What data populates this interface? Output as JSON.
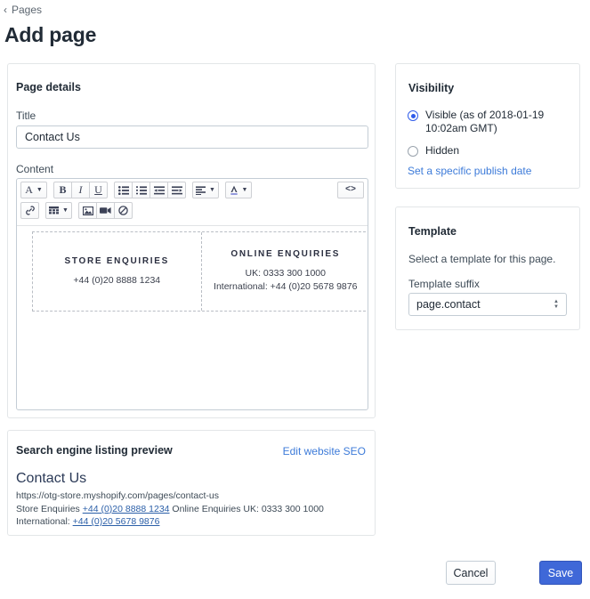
{
  "breadcrumb": {
    "label": "Pages",
    "icon": "chevron-left-icon"
  },
  "page_title": "Add page",
  "page_details": {
    "card_title": "Page details",
    "title_label": "Title",
    "title_value": "Contact Us",
    "title_placeholder": "",
    "content_label": "Content",
    "toolbar": {
      "row1": [
        {
          "name": "font-style-dropdown",
          "glyph": "A",
          "caret": true
        },
        {
          "name": "bold-button",
          "glyph": "B",
          "caret": false
        },
        {
          "name": "italic-button",
          "glyph": "I",
          "caret": false
        },
        {
          "name": "underline-button",
          "glyph": "U",
          "caret": false
        },
        {
          "name": "bulleted-list-button",
          "glyph": "list-bullet-icon",
          "caret": false
        },
        {
          "name": "numbered-list-button",
          "glyph": "list-number-icon",
          "caret": false
        },
        {
          "name": "outdent-button",
          "glyph": "outdent-icon",
          "caret": false
        },
        {
          "name": "indent-button",
          "glyph": "indent-icon",
          "caret": false
        },
        {
          "name": "align-dropdown",
          "glyph": "align-left-icon",
          "caret": true
        },
        {
          "name": "text-color-dropdown",
          "glyph": "text-color-icon",
          "caret": true
        },
        {
          "name": "edit-html-button",
          "glyph": "code-icon",
          "caret": false
        }
      ],
      "row2": [
        {
          "name": "insert-link-button",
          "glyph": "link-icon",
          "caret": false
        },
        {
          "name": "insert-table-dropdown",
          "glyph": "table-icon",
          "caret": true
        },
        {
          "name": "insert-image-button",
          "glyph": "image-icon",
          "caret": false
        },
        {
          "name": "insert-video-button",
          "glyph": "video-icon",
          "caret": false
        },
        {
          "name": "clear-formatting-button",
          "glyph": "no-formatting-icon",
          "caret": false
        }
      ]
    },
    "content_table": {
      "cells": [
        {
          "heading": "STORE ENQUIRIES",
          "lines": [
            "+44 (0)20 8888 1234"
          ]
        },
        {
          "heading": "ONLINE ENQUIRIES",
          "lines": [
            "UK: 0333 300 1000",
            "International: +44 (0)20 5678 9876"
          ]
        }
      ]
    },
    "scrollbars": {
      "left_arrow": "‹",
      "right_arrow": "›",
      "thumb_percent": 83
    }
  },
  "seo": {
    "card_title": "Search engine listing preview",
    "edit_link": "Edit website SEO",
    "heading": "Contact Us",
    "url": "https://otg-store.myshopify.com/pages/contact-us",
    "description_parts": [
      {
        "text": "Store Enquiries ",
        "link": false
      },
      {
        "text": "+44 (0)20 8888 1234",
        "link": true
      },
      {
        "text": " Online Enquiries UK: 0333 300 1000 International: ",
        "link": false
      },
      {
        "text": "+44 (0)20 5678 9876",
        "link": true
      }
    ]
  },
  "visibility": {
    "card_title": "Visibility",
    "options": [
      {
        "label": "Visible (as of 2018-01-19 10:02am GMT)",
        "selected": true
      },
      {
        "label": "Hidden",
        "selected": false
      }
    ],
    "publish_date_link": "Set a specific publish date"
  },
  "template": {
    "card_title": "Template",
    "description": "Select a template for this page.",
    "suffix_label": "Template suffix",
    "suffix_value": "page.contact",
    "suffix_options": [
      "page.contact"
    ]
  },
  "footer": {
    "cancel_label": "Cancel",
    "save_label": "Save"
  },
  "colors": {
    "accent_blue": "#3f68d8",
    "link_blue": "#3d7bd9",
    "radio_blue": "#2f5bea",
    "border_grey": "#c4cdd5",
    "card_border": "#e3e6e8",
    "text_dark": "#212b36",
    "text_muted": "#3e4b57"
  }
}
